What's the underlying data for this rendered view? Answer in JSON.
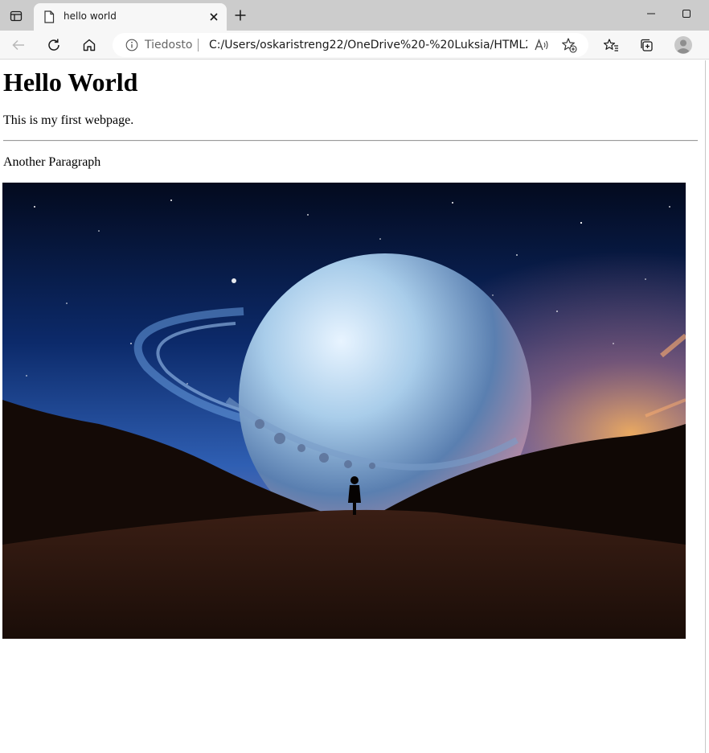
{
  "tab": {
    "title": "hello world"
  },
  "addressbar": {
    "site_label": "Tiedosto",
    "url": "C:/Users/oskaristreng22/OneDrive%20-%20Luksia/HTML2/Ind..."
  },
  "icons": {
    "tab_actions": "tab-actions-icon",
    "favicon": "file-icon",
    "close": "close-icon",
    "new_tab": "plus-icon",
    "minimize": "minimize-icon",
    "maximize": "maximize-icon",
    "back": "back-arrow-icon",
    "reload": "reload-icon",
    "home": "home-icon",
    "info": "info-icon",
    "read_aloud": "read-aloud-icon",
    "add_favorite": "star-add-icon",
    "favorites": "favorites-icon",
    "collections": "collections-icon",
    "profile": "profile-avatar-icon"
  },
  "page": {
    "heading": "Hello World",
    "paragraph1": "This is my first webpage.",
    "paragraph2": "Another Paragraph"
  },
  "colors": {
    "tabstrip_bg": "#cccccc",
    "toolbar_bg": "#f7f7f7",
    "page_bg": "#ffffff"
  }
}
